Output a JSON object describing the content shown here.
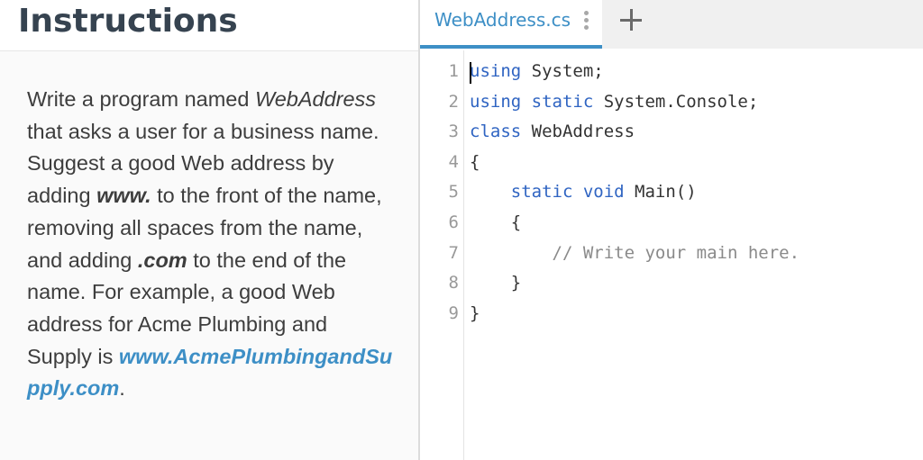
{
  "instructions": {
    "title": "Instructions",
    "desc": {
      "p1": "Write a program named ",
      "program_name": "WebAddress",
      "p2": " that asks a user for a business name. Suggest a good Web address by adding ",
      "www": "www.",
      "p3": " to the front of the name, removing all spaces from the name, and adding ",
      "com": ".com",
      "p4": " to the end of the name. For example, a good Web address for Acme Plumbing and Supply is ",
      "example": "www.AcmePlumbingandSupply.com",
      "p5": "."
    }
  },
  "editor": {
    "tab_label": "WebAddress.cs",
    "lines": [
      {
        "n": "1",
        "parts": [
          [
            "kw",
            "using"
          ],
          [
            "t",
            " System;"
          ]
        ]
      },
      {
        "n": "2",
        "parts": [
          [
            "kw",
            "using static"
          ],
          [
            "t",
            " System.Console;"
          ]
        ]
      },
      {
        "n": "3",
        "parts": [
          [
            "kw",
            "class"
          ],
          [
            "t",
            " WebAddress"
          ]
        ]
      },
      {
        "n": "4",
        "parts": [
          [
            "t",
            "{"
          ]
        ]
      },
      {
        "n": "5",
        "parts": [
          [
            "t",
            "    "
          ],
          [
            "kw",
            "static void"
          ],
          [
            "t",
            " Main()"
          ]
        ]
      },
      {
        "n": "6",
        "parts": [
          [
            "t",
            "    {"
          ]
        ]
      },
      {
        "n": "7",
        "parts": [
          [
            "t",
            "        "
          ],
          [
            "cm",
            "// Write your main here."
          ]
        ]
      },
      {
        "n": "8",
        "parts": [
          [
            "t",
            "    }"
          ]
        ]
      },
      {
        "n": "9",
        "parts": [
          [
            "t",
            "}"
          ]
        ]
      }
    ]
  },
  "colors": {
    "accent": "#3d8fc6",
    "keyword": "#2f64c2",
    "title": "#364350"
  }
}
